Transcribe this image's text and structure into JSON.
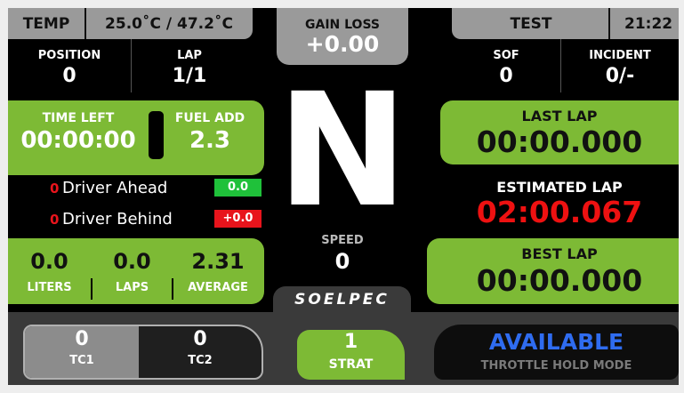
{
  "top": {
    "temp_label": "TEMP",
    "temp_value": "25.0˚C / 47.2˚C",
    "gain_label": "GAIN LOSS",
    "gain_value": "+0.00",
    "test_label": "TEST",
    "clock": "21:22"
  },
  "stats_left": {
    "position_label": "POSITION",
    "position_value": "0",
    "lap_label": "LAP",
    "lap_value": "1/1"
  },
  "stats_right": {
    "sof_label": "SOF",
    "sof_value": "0",
    "incident_label": "INCIDENT",
    "incident_value": "0/-"
  },
  "time_fuel": {
    "time_left_label": "TIME LEFT",
    "time_left_value": "00:00:00",
    "fuel_add_label": "FUEL ADD",
    "fuel_add_value": "2.3"
  },
  "drivers": {
    "ahead_pos": "0",
    "ahead_label": "Driver Ahead",
    "ahead_gap": "0.0",
    "behind_pos": "0",
    "behind_label": "Driver Behind",
    "behind_gap": "+0.0"
  },
  "fuel": {
    "liters_value": "0.0",
    "liters_label": "LITERS",
    "laps_value": "0.0",
    "laps_label": "LAPS",
    "average_value": "2.31",
    "average_label": "AVERAGE"
  },
  "center": {
    "gear": "N",
    "speed_label": "SPEED",
    "speed_value": "0",
    "logo": "SOELPEC"
  },
  "laps": {
    "last_label": "LAST LAP",
    "last_value": "00:00.000",
    "estimated_label": "ESTIMATED LAP",
    "estimated_value": "02:00.067",
    "best_label": "BEST LAP",
    "best_value": "00:00.000"
  },
  "bottom": {
    "tc1_value": "0",
    "tc1_label": "TC1",
    "tc2_value": "0",
    "tc2_label": "TC2",
    "strat_value": "1",
    "strat_label": "STRAT",
    "throttle_status": "AVAILABLE",
    "throttle_label": "THROTTLE HOLD MODE"
  },
  "colors": {
    "green_panel": "#7dba35",
    "grey_panel": "#9a9a9a",
    "delta_positive": "#1fc13a",
    "delta_negative": "#e8141c",
    "estimated_red": "#ee1111",
    "available_blue": "#2f6cf0"
  }
}
